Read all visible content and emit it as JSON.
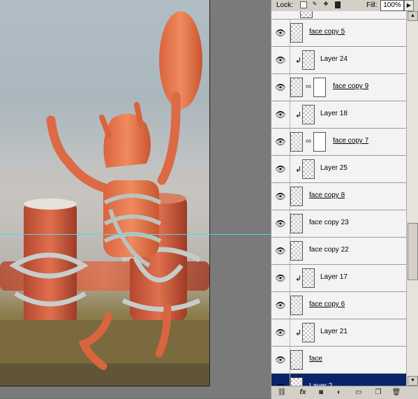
{
  "lock_bar": {
    "lock_label": "Lock:",
    "fill_label": "Fill:",
    "fill_value": "100%"
  },
  "layers": [
    {
      "name": "face copy 5",
      "clipped": false,
      "has_mask": false,
      "underlined": true,
      "selected": false
    },
    {
      "name": "Layer 24",
      "clipped": true,
      "has_mask": false,
      "underlined": false,
      "selected": false
    },
    {
      "name": "face copy 9",
      "clipped": false,
      "has_mask": true,
      "underlined": true,
      "selected": false
    },
    {
      "name": "Layer 18",
      "clipped": true,
      "has_mask": false,
      "underlined": false,
      "selected": false
    },
    {
      "name": "face copy 7",
      "clipped": false,
      "has_mask": true,
      "underlined": true,
      "selected": false
    },
    {
      "name": "Layer 25",
      "clipped": true,
      "has_mask": false,
      "underlined": false,
      "selected": false
    },
    {
      "name": "face copy 8",
      "clipped": false,
      "has_mask": false,
      "underlined": true,
      "selected": false
    },
    {
      "name": "face copy 23",
      "clipped": false,
      "has_mask": false,
      "underlined": false,
      "selected": false
    },
    {
      "name": "face copy 22",
      "clipped": false,
      "has_mask": false,
      "underlined": false,
      "selected": false
    },
    {
      "name": "Layer 17",
      "clipped": true,
      "has_mask": false,
      "underlined": false,
      "selected": false
    },
    {
      "name": "face copy 6",
      "clipped": false,
      "has_mask": false,
      "underlined": true,
      "selected": false
    },
    {
      "name": "Layer 21",
      "clipped": true,
      "has_mask": false,
      "underlined": false,
      "selected": false
    },
    {
      "name": "face",
      "clipped": false,
      "has_mask": false,
      "underlined": true,
      "selected": false
    },
    {
      "name": "Layer 2",
      "clipped": false,
      "has_mask": false,
      "underlined": false,
      "selected": true
    }
  ],
  "icons": {
    "eye": "eye-icon",
    "clip": "clipping-arrow-icon",
    "chain": "chain-link-icon",
    "bottom": [
      "link-layers-icon",
      "fx-icon",
      "add-mask-icon",
      "adjustment-layer-icon",
      "new-group-icon",
      "new-layer-icon",
      "delete-layer-icon"
    ]
  },
  "colors": {
    "selection": "#0a246a",
    "guide": "#4fd5e6",
    "panel": "#d4d0c8"
  }
}
